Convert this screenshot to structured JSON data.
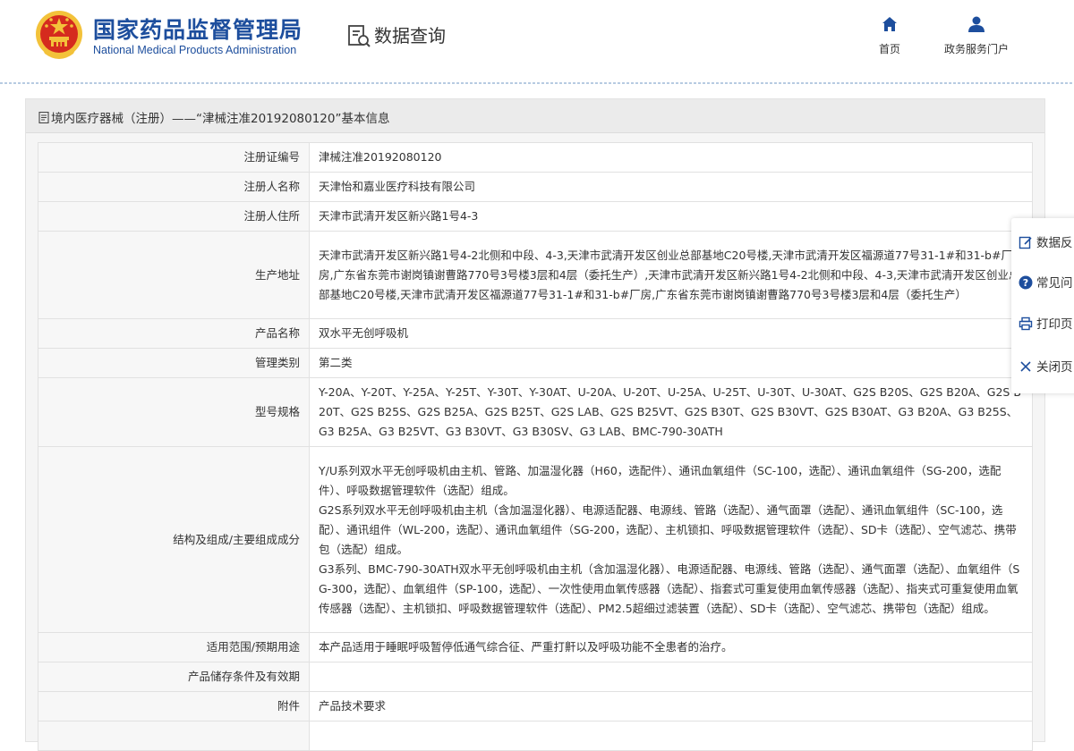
{
  "header": {
    "org_name_cn": "国家药品监督管理局",
    "org_name_en": "National Medical Products Administration",
    "section_title": "数据查询",
    "nav": [
      {
        "label": "首页",
        "icon": "home-icon"
      },
      {
        "label": "政务服务门户",
        "icon": "user-icon"
      }
    ]
  },
  "panel": {
    "title": "境内医疗器械（注册）——“津械注准20192080120”基本信息"
  },
  "rows": [
    {
      "label": "注册证编号",
      "value": "津械注准20192080120"
    },
    {
      "label": "注册人名称",
      "value": "天津怡和嘉业医疗科技有限公司"
    },
    {
      "label": "注册人住所",
      "value": "天津市武清开发区新兴路1号4-3"
    },
    {
      "label": "生产地址",
      "value": "天津市武清开发区新兴路1号4-2北侧和中段、4-3,天津市武清开发区创业总部基地C20号楼,天津市武清开发区福源道77号31-1#和31-b#厂房,广东省东莞市谢岗镇谢曹路770号3号楼3层和4层（委托生产）,天津市武清开发区新兴路1号4-2北侧和中段、4-3,天津市武清开发区创业总部基地C20号楼,天津市武清开发区福源道77号31-1#和31-b#厂房,广东省东莞市谢岗镇谢曹路770号3号楼3层和4层（委托生产）"
    },
    {
      "label": "产品名称",
      "value": "双水平无创呼吸机"
    },
    {
      "label": "管理类别",
      "value": "第二类"
    },
    {
      "label": "型号规格",
      "value": "Y-20A、Y-20T、Y-25A、Y-25T、Y-30T、Y-30AT、U-20A、U-20T、U-25A、U-25T、U-30T、U-30AT、G2S B20S、G2S B20A、G2S B20T、G2S B25S、G2S B25A、G2S B25T、G2S LAB、G2S B25VT、G2S B30T、G2S B30VT、G2S B30AT、G3 B20A、G3 B25S、G3 B25A、G3 B25VT、G3 B30VT、G3 B30SV、G3 LAB、BMC-790-30ATH"
    },
    {
      "label": "结构及组成/主要组成成分",
      "lines": [
        "Y/U系列双水平无创呼吸机由主机、管路、加温湿化器（H60，选配件）、通讯血氧组件（SC-100，选配）、通讯血氧组件（SG-200，选配件）、呼吸数据管理软件（选配）组成。",
        "G2S系列双水平无创呼吸机由主机（含加温湿化器）、电源适配器、电源线、管路（选配）、通气面罩（选配）、通讯血氧组件（SC-100，选配）、通讯组件（WL-200，选配）、通讯血氧组件（SG-200，选配）、主机锁扣、呼吸数据管理软件（选配）、SD卡（选配）、空气滤芯、携带包（选配）组成。",
        "G3系列、BMC-790-30ATH双水平无创呼吸机由主机（含加温湿化器）、电源适配器、电源线、管路（选配）、通气面罩（选配）、血氧组件（SG-300，选配）、血氧组件（SP-100，选配）、一次性使用血氧传感器（选配）、指套式可重复使用血氧传感器（选配）、指夹式可重复使用血氧传感器（选配）、主机锁扣、呼吸数据管理软件（选配）、PM2.5超细过滤装置（选配）、SD卡（选配）、空气滤芯、携带包（选配）组成。"
      ]
    },
    {
      "label": "适用范围/预期用途",
      "value": "本产品适用于睡眠呼吸暂停低通气综合征、严重打鼾以及呼吸功能不全患者的治疗。"
    },
    {
      "label": "产品储存条件及有效期",
      "value": ""
    },
    {
      "label": "附件",
      "value": "产品技术要求"
    },
    {
      "label": "",
      "value": ""
    }
  ],
  "sidebar": [
    {
      "label": "数据反",
      "icon": "edit-icon"
    },
    {
      "label": "常见问",
      "icon": "question-icon"
    },
    {
      "label": "打印页",
      "icon": "printer-icon"
    },
    {
      "label": "关闭页",
      "icon": "close-icon"
    }
  ],
  "colors": {
    "brand_blue": "#1d4e9d",
    "emblem_red": "#d52b1e",
    "emblem_gold": "#f3c23a"
  }
}
